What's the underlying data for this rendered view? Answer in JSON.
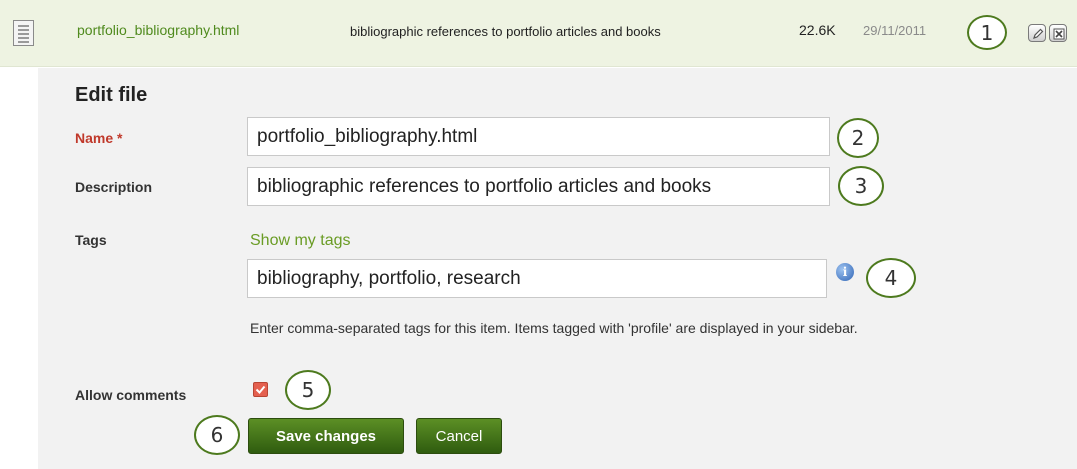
{
  "file_row": {
    "name": "portfolio_bibliography.html",
    "description": "bibliographic references to portfolio articles and books",
    "size": "22.6K",
    "date": "29/11/2011",
    "edit_icon": "pencil-icon",
    "delete_icon": "delete-icon"
  },
  "form": {
    "title": "Edit file",
    "name_label": "Name",
    "required_marker": "*",
    "name_value": "portfolio_bibliography.html",
    "description_label": "Description",
    "description_value": "bibliographic references to portfolio articles and books",
    "tags_label": "Tags",
    "show_tags_link": "Show my tags",
    "tags_value": "bibliography, portfolio, research",
    "tags_help": "Enter comma-separated tags for this item. Items tagged with 'profile' are displayed in your sidebar.",
    "info_icon": "info-icon",
    "allow_comments_label": "Allow comments",
    "allow_comments_checked": true,
    "save_button": "Save changes",
    "cancel_button": "Cancel"
  },
  "callouts": [
    "1",
    "2",
    "3",
    "4",
    "5",
    "6"
  ],
  "colors": {
    "accent_green": "#4f8a1d",
    "button_green": "#3d6e17",
    "required_red": "#c0392b",
    "file_row_bg": "#eef3e2",
    "panel_bg": "#f2f2f2"
  }
}
